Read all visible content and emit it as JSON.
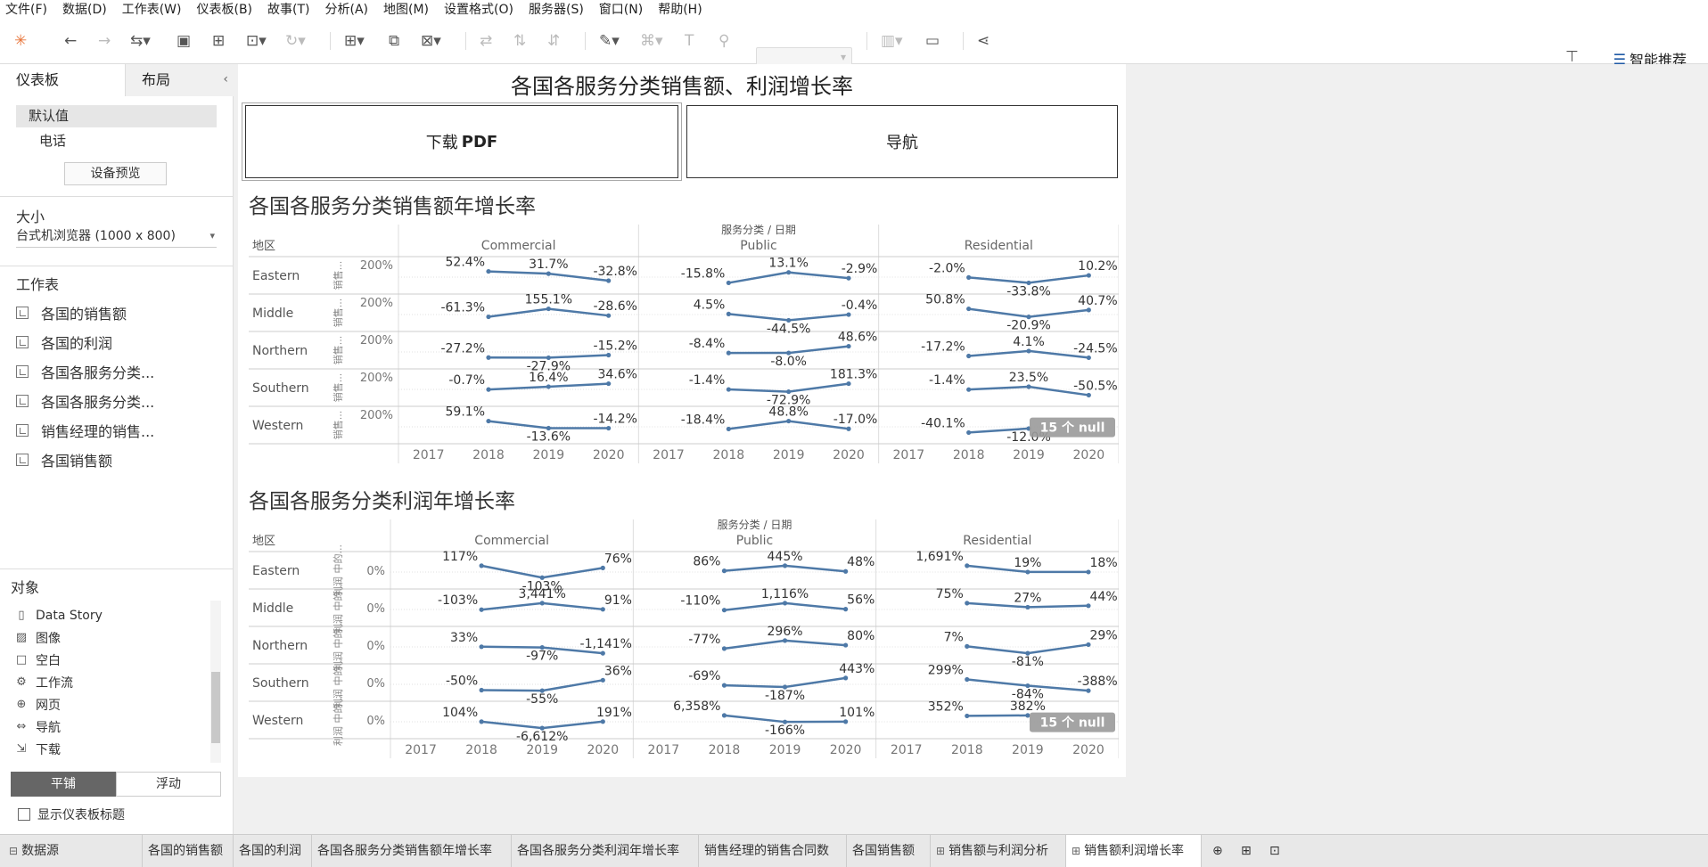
{
  "menu": [
    "文件(F)",
    "数据(D)",
    "工作表(W)",
    "仪表板(B)",
    "故事(T)",
    "分析(A)",
    "地图(M)",
    "设置格式(O)",
    "服务器(S)",
    "窗口(N)",
    "帮助(H)"
  ],
  "toolbar": {
    "smart": "智能推荐"
  },
  "left": {
    "tab_dashboard": "仪表板",
    "tab_layout": "布局",
    "device_default": "默认值",
    "device_phone": "电话",
    "preview_btn": "设备预览",
    "size_header": "大小",
    "size_value": "台式机浏览器 (1000 x 800)",
    "ws_header": "工作表",
    "worksheets": [
      "各国的销售额",
      "各国的利润",
      "各国各服务分类...",
      "各国各服务分类...",
      "销售经理的销售...",
      "各国销售额"
    ],
    "obj_header": "对象",
    "objects": [
      "Data Story",
      "图像",
      "空白",
      "工作流",
      "网页",
      "导航",
      "下载"
    ],
    "tile": "平铺",
    "float": "浮动",
    "show_title": "显示仪表板标题"
  },
  "dashboard": {
    "title": "各国各服务分类销售额、利润增长率",
    "btn_pdf_pre": "下载",
    "btn_pdf_bold": "PDF",
    "btn_nav": "导航"
  },
  "views": [
    {
      "title": "各国各服务分类销售额年增长率",
      "header": "服务分类 / 日期",
      "region_label": "地区",
      "measure_axis": "销售...",
      "axis_tick": "200%",
      "categories": [
        "Commercial",
        "Public",
        "Residential"
      ],
      "years": [
        "2017",
        "2018",
        "2019",
        "2020"
      ],
      "null_badge": "15 个 null",
      "rows": [
        {
          "region": "Eastern",
          "cells": [
            [
              "52.4%",
              "31.7%",
              "-32.8%"
            ],
            [
              "-15.8%",
              "13.1%",
              "-2.9%"
            ],
            [
              "-2.0%",
              "-33.8%",
              "10.2%"
            ]
          ]
        },
        {
          "region": "Middle",
          "cells": [
            [
              "-61.3%",
              "155.1%",
              "-28.6%"
            ],
            [
              "4.5%",
              "-44.5%",
              "-0.4%"
            ],
            [
              "50.8%",
              "-20.9%",
              "40.7%"
            ]
          ]
        },
        {
          "region": "Northern",
          "cells": [
            [
              "-27.2%",
              "-27.9%",
              "-15.2%"
            ],
            [
              "-8.4%",
              "-8.0%",
              "48.6%"
            ],
            [
              "-17.2%",
              "4.1%",
              "-24.5%"
            ]
          ]
        },
        {
          "region": "Southern",
          "cells": [
            [
              "-0.7%",
              "16.4%",
              "34.6%"
            ],
            [
              "-1.4%",
              "-72.9%",
              "181.3%"
            ],
            [
              "-1.4%",
              "23.5%",
              "-50.5%"
            ]
          ]
        },
        {
          "region": "Western",
          "cells": [
            [
              "59.1%",
              "-13.6%",
              "-14.2%"
            ],
            [
              "-18.4%",
              "48.8%",
              "-17.0%"
            ],
            [
              "-40.1%",
              "-12.0%",
              ""
            ]
          ]
        }
      ]
    },
    {
      "title": "各国各服务分类利润年增长率",
      "header": "服务分类 / 日期",
      "region_label": "地区",
      "measure_axis": "利润 中的...",
      "axis_tick": "0%",
      "categories": [
        "Commercial",
        "Public",
        "Residential"
      ],
      "years": [
        "2017",
        "2018",
        "2019",
        "2020"
      ],
      "null_badge": "15 个 null",
      "rows": [
        {
          "region": "Eastern",
          "cells": [
            [
              "117%",
              "-103%",
              "76%"
            ],
            [
              "86%",
              "445%",
              "48%"
            ],
            [
              "1,691%",
              "19%",
              "18%"
            ]
          ]
        },
        {
          "region": "Middle",
          "cells": [
            [
              "-103%",
              "3,441%",
              "91%"
            ],
            [
              "-110%",
              "1,116%",
              "56%"
            ],
            [
              "75%",
              "27%",
              "44%"
            ]
          ]
        },
        {
          "region": "Northern",
          "cells": [
            [
              "33%",
              "-97%",
              "-1,141%"
            ],
            [
              "-77%",
              "296%",
              "80%"
            ],
            [
              "7%",
              "-81%",
              "29%"
            ]
          ]
        },
        {
          "region": "Southern",
          "cells": [
            [
              "-50%",
              "-55%",
              "36%"
            ],
            [
              "-69%",
              "-187%",
              "443%"
            ],
            [
              "299%",
              "-84%",
              "-388%"
            ]
          ]
        },
        {
          "region": "Western",
          "cells": [
            [
              "104%",
              "-6,612%",
              "191%"
            ],
            [
              "6,358%",
              "-166%",
              "101%"
            ],
            [
              "352%",
              "382%",
              ""
            ]
          ]
        }
      ]
    }
  ],
  "sheet_tabs": [
    "数据源",
    "各国的销售额",
    "各国的利润",
    "各国各服务分类销售额年增长率",
    "各国各服务分类利润年增长率",
    "销售经理的销售合同数",
    "各国销售额",
    "销售额与利润分析",
    "销售额利润增长率"
  ],
  "colors": {
    "line": "#4e79a7",
    "null_badge": "#9a9a9a"
  }
}
